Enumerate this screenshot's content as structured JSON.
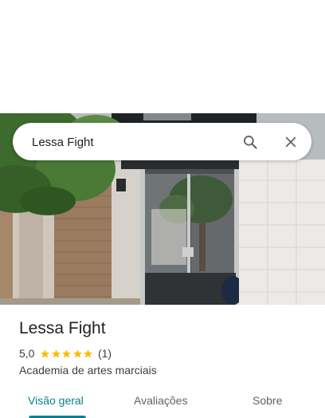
{
  "search": {
    "value": "Lessa Fight",
    "search_icon": "search-icon",
    "close_icon": "close-icon"
  },
  "place": {
    "name": "Lessa Fight",
    "rating": "5,0",
    "rating_value": 5,
    "rating_max": 5,
    "review_count": "(1)",
    "category": "Academia de artes marciais"
  },
  "tabs": [
    {
      "label": "Visão geral",
      "active": true
    },
    {
      "label": "Avaliações",
      "active": false
    },
    {
      "label": "Sobre",
      "active": false
    }
  ],
  "colors": {
    "accent": "#0b7f8d",
    "star": "#fbbc04"
  }
}
